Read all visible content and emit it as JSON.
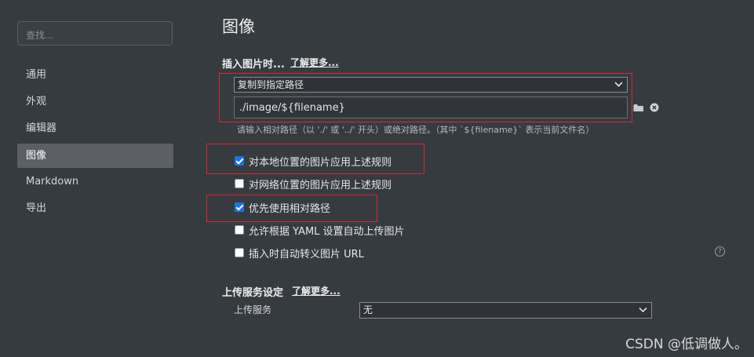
{
  "sidebar": {
    "search_placeholder": "查找...",
    "items": [
      {
        "label": "通用",
        "active": false
      },
      {
        "label": "外观",
        "active": false
      },
      {
        "label": "编辑器",
        "active": false
      },
      {
        "label": "图像",
        "active": true
      },
      {
        "label": "Markdown",
        "active": false
      },
      {
        "label": "导出",
        "active": false
      }
    ]
  },
  "main": {
    "title": "图像",
    "insert_section": {
      "label": "插入图片时...",
      "learn_more": "了解更多...",
      "action_select": "复制到指定路径",
      "path_value": "./image/${filename}",
      "hint": "请输入相对路径（以 './' 或 '../' 开头）或绝对路径。（其中 `${filename}` 表示当前文件名）",
      "folder_icon": "folder-icon",
      "clear_icon": "close-circle-icon"
    },
    "options": [
      {
        "label": "对本地位置的图片应用上述规则",
        "checked": true
      },
      {
        "label": "对网络位置的图片应用上述规则",
        "checked": false
      },
      {
        "label": "优先使用相对路径",
        "checked": true
      },
      {
        "label": "允许根据 YAML 设置自动上传图片",
        "checked": false
      },
      {
        "label": "插入时自动转义图片 URL",
        "checked": false
      }
    ],
    "help_icon": "question-circle-icon",
    "upload_section": {
      "label": "上传服务设定",
      "learn_more": "了解更多...",
      "service_label": "上传服务",
      "service_value": "无"
    }
  },
  "watermark": "CSDN @低调做人。",
  "colors": {
    "background": "#363b40",
    "active_nav": "#5c6065",
    "highlight_box": "#e0262e",
    "checkbox_checked": "#1a73e8"
  }
}
